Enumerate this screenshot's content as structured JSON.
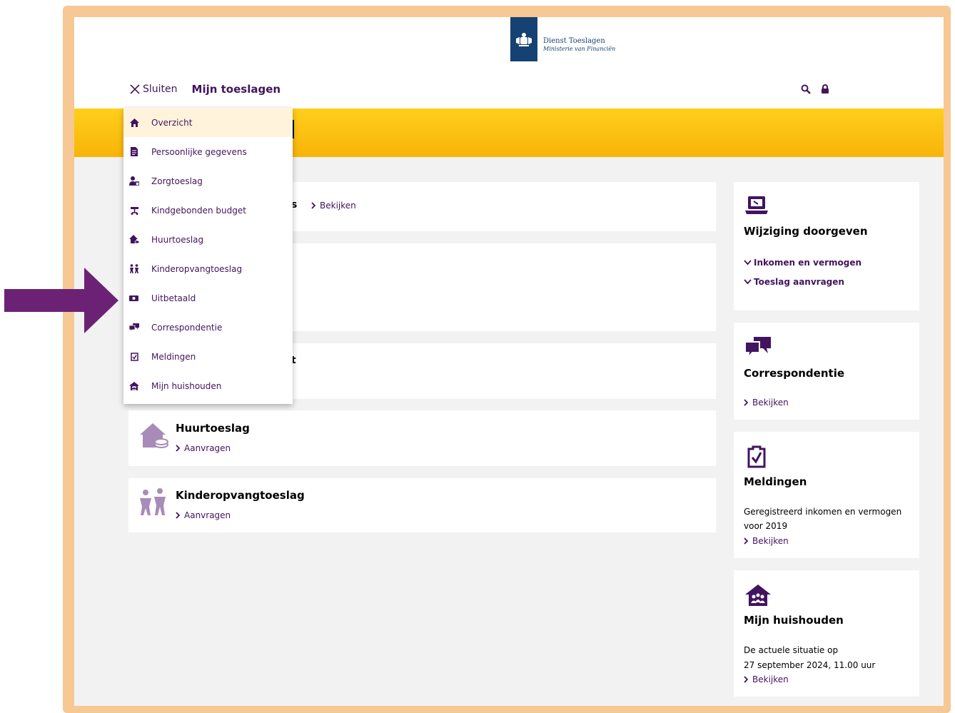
{
  "logo": {
    "line1": "Dienst Toeslagen",
    "line2": "Ministerie van Financiën"
  },
  "nav": {
    "close_label": "Sluiten",
    "title": "Mijn toeslagen"
  },
  "menu": [
    {
      "label": "Overzicht",
      "icon": "home-icon",
      "active": true
    },
    {
      "label": "Persoonlijke gegevens",
      "icon": "document-icon"
    },
    {
      "label": "Zorgtoeslag",
      "icon": "person-care-icon"
    },
    {
      "label": "Kindgebonden budget",
      "icon": "stroller-icon"
    },
    {
      "label": "Huurtoeslag",
      "icon": "house-coins-icon"
    },
    {
      "label": "Kinderopvangtoeslag",
      "icon": "children-icon"
    },
    {
      "label": "Uitbetaald",
      "icon": "payment-icon"
    },
    {
      "label": "Correspondentie",
      "icon": "speech-bubbles-icon"
    },
    {
      "label": "Meldingen",
      "icon": "checklist-icon"
    },
    {
      "label": "Mijn huishouden",
      "icon": "household-icon"
    }
  ],
  "main": {
    "card1": {
      "fragment": "s",
      "link": "Bekijken"
    },
    "card3": {
      "fragment": "t"
    },
    "huurtoeslag": {
      "title": "Huurtoeslag",
      "link": "Aanvragen"
    },
    "kinderopvang": {
      "title": "Kinderopvangtoeslag",
      "link": "Aanvragen"
    }
  },
  "side": {
    "wijziging": {
      "title": "Wijziging doorgeven",
      "links": [
        "Inkomen en vermogen",
        "Toeslag aanvragen"
      ]
    },
    "correspondentie": {
      "title": "Correspondentie",
      "link": "Bekijken"
    },
    "meldingen": {
      "title": "Meldingen",
      "text1": "Geregistreerd inkomen en vermogen",
      "text2": "voor 2019",
      "link": "Bekijken"
    },
    "huishouden": {
      "title": "Mijn huishouden",
      "text1": "De actuele situatie op",
      "text2": "27 september 2024, 11.00 uur",
      "link": "Bekijken"
    }
  },
  "colors": {
    "brand_purple": "#42145f",
    "banner_yellow": "#ffcf1c",
    "frame_peach": "#f5c894",
    "rijks_blue": "#154273"
  }
}
